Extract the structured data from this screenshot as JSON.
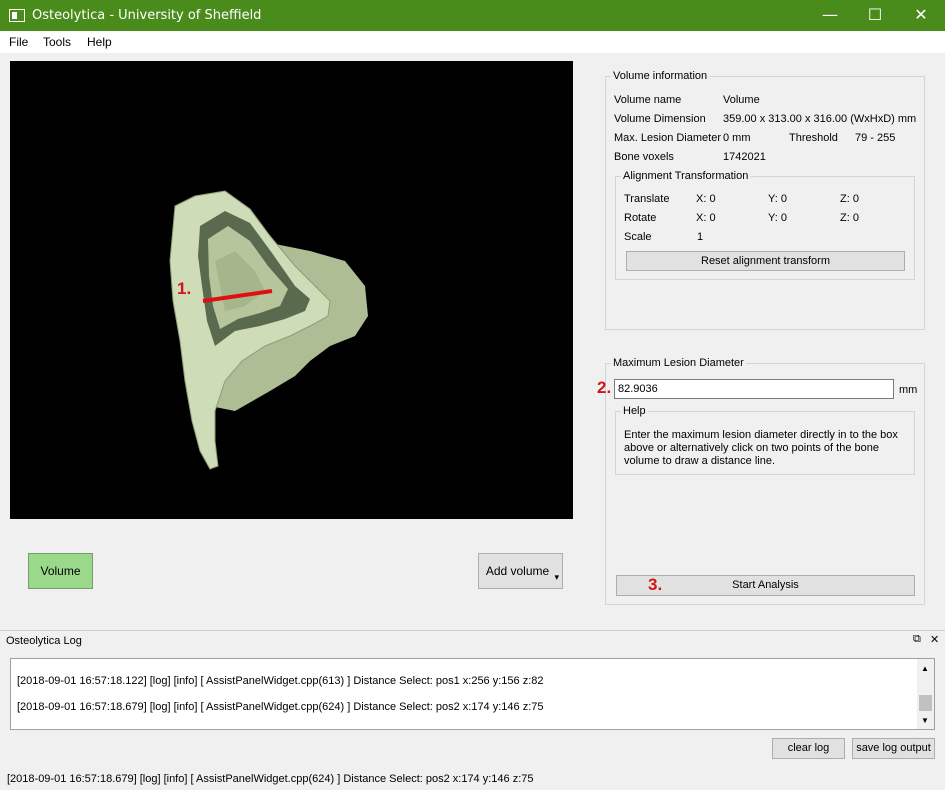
{
  "window": {
    "title": "Osteolytica - University of Sheffield",
    "minimize": "—",
    "maximize": "☐",
    "close": "✕",
    "accent": "#4a8c1c"
  },
  "menu": [
    "File",
    "Tools",
    "Help"
  ],
  "viewport": {
    "markers": {
      "one": "1.",
      "two": "2.",
      "three": "3."
    },
    "bone_color": "#cfdcb8",
    "line_color": "#e01010"
  },
  "buttons": {
    "volume": "Volume",
    "add_volume": "Add volume",
    "add_volume_arrow": "▾",
    "reset_alignment": "Reset alignment transform",
    "start_analysis": "Start Analysis",
    "clear_log": "clear log",
    "save_log": "save log output"
  },
  "volume_info": {
    "title": "Volume information",
    "name_label": "Volume name",
    "name_value": "Volume",
    "dimension_label": "Volume Dimension",
    "dimension_value": "359.00 x 313.00 x 316.00 (WxHxD) mm",
    "max_lesion_label": "Max. Lesion Diameter",
    "max_lesion_value": "0 mm",
    "threshold_label": "Threshold",
    "threshold_value": "79 - 255",
    "bone_voxels_label": "Bone voxels",
    "bone_voxels_value": "1742021"
  },
  "alignment": {
    "title": "Alignment Transformation",
    "translate_label": "Translate",
    "rotate_label": "Rotate",
    "scale_label": "Scale",
    "translate": {
      "x": "X: 0",
      "y": "Y: 0",
      "z": "Z: 0"
    },
    "rotate": {
      "x": "X: 0",
      "y": "Y: 0",
      "z": "Z: 0"
    },
    "scale": "1"
  },
  "lesion": {
    "title": "Maximum Lesion Diameter",
    "value": "82.9036",
    "unit": "mm",
    "help_title": "Help",
    "help_line1": "Enter the maximum lesion diameter directly in to the box",
    "help_line2": "above or alternatively click on two points of the bone",
    "help_line3": "volume to draw a distance line."
  },
  "log": {
    "title": "Osteolytica Log",
    "float_icon": "⧉",
    "close_icon": "✕",
    "lines": [
      "[2018-09-01 16:57:18.122] [log] [info] [ AssistPanelWidget.cpp(613) ] Distance Select: pos1 x:256 y:156 z:82",
      "[2018-09-01 16:57:18.679] [log] [info] [ AssistPanelWidget.cpp(624) ] Distance Select: pos2 x:174 y:146 z:75"
    ]
  },
  "status": "[2018-09-01 16:57:18.679] [log] [info] [ AssistPanelWidget.cpp(624) ] Distance Select: pos2 x:174 y:146 z:75"
}
